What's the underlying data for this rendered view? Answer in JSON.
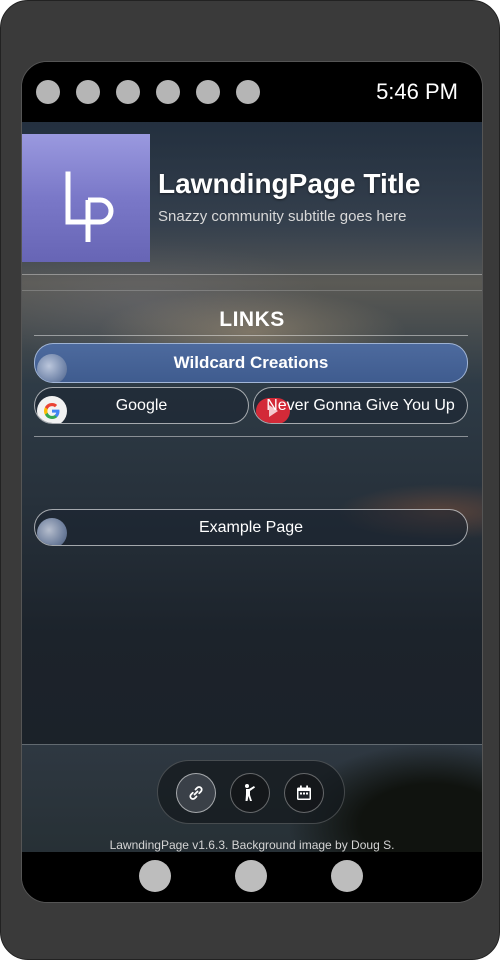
{
  "status_bar": {
    "time": "5:46 PM",
    "indicator_count": 6
  },
  "header": {
    "logo_text": "LP",
    "title": "LawndingPage Title",
    "subtitle": "Snazzy community subtitle goes here"
  },
  "links": {
    "heading": "LINKS",
    "featured": {
      "label": "Wildcard Creations",
      "icon": "globe-icon"
    },
    "row": [
      {
        "label": "Google",
        "icon": "google-icon"
      },
      {
        "label": "Never Gonna Give You Up",
        "icon": "youtube-icon"
      }
    ],
    "other": {
      "label": "Example Page",
      "icon": "globe-icon"
    }
  },
  "nav": {
    "buttons": [
      {
        "icon": "link-icon",
        "active": true
      },
      {
        "icon": "person-icon",
        "active": false
      },
      {
        "icon": "calendar-icon",
        "active": false
      }
    ]
  },
  "footer": {
    "credit": "LawndingPage v1.6.3. Background image by Doug S."
  },
  "colors": {
    "logo_top": "#9a99df",
    "logo_bottom": "#6765b5",
    "featured_button": "#4d6a9e",
    "youtube_red": "#d32a38"
  }
}
